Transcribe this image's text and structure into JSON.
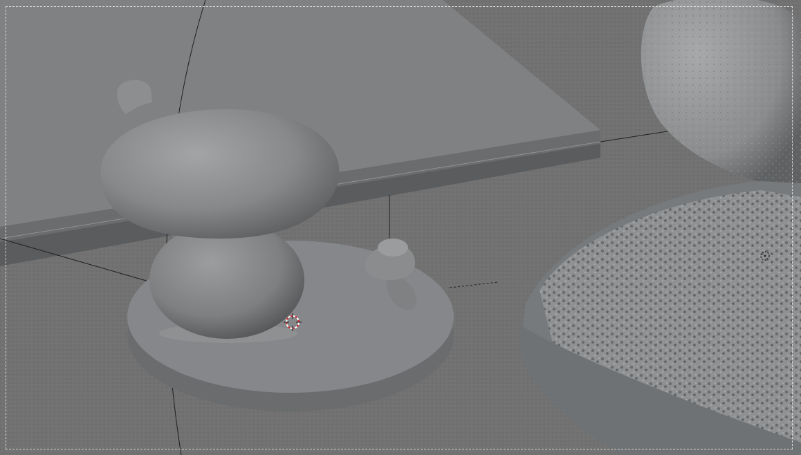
{
  "viewport": {
    "mode": "3d-viewport-solid-shading",
    "background_color": "#7c7c7c",
    "ground_color": "#6f6f6f",
    "object_color": "#8a8a8a",
    "frame_style": "dashed",
    "cursor_colors": [
      "#d8262b",
      "#ffffff"
    ]
  },
  "objects": [
    {
      "name": "table-slab",
      "type": "mesh"
    },
    {
      "name": "mushroom-large",
      "type": "mesh"
    },
    {
      "name": "mushroom-small",
      "type": "mesh"
    },
    {
      "name": "round-base-plate",
      "type": "mesh"
    },
    {
      "name": "bread-loaf-top",
      "type": "mesh"
    },
    {
      "name": "bread-slice",
      "type": "mesh"
    }
  ],
  "icons": {
    "cursor": "3d-cursor-icon",
    "origin": "object-origin-icon"
  }
}
